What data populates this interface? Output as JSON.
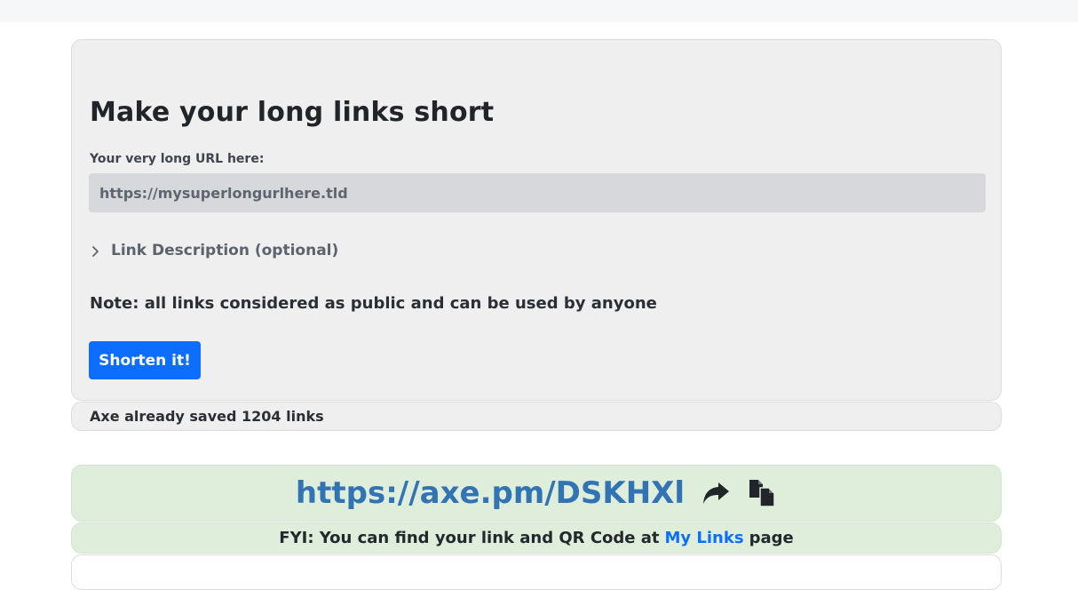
{
  "form": {
    "title": "Make your long links short",
    "url_label": "Your very long URL here:",
    "url_placeholder": "https://mysuperlongurlhere.tld",
    "url_value": "",
    "description_toggle": "Link Description (optional)",
    "note": "Note: all links considered as public and can be used by anyone",
    "submit_label": "Shorten it!"
  },
  "stats": {
    "text": "Axe already saved 1204 links"
  },
  "result": {
    "short_url": "https://axe.pm/DSKHXl",
    "share_icon": "share-arrow-icon",
    "copy_icon": "copy-icon",
    "fyi_prefix": "FYI: You can find your link and QR Code at",
    "fyi_link": "My Links",
    "fyi_suffix": "page"
  },
  "colors": {
    "primary": "#0d6efd",
    "link": "#3273b4",
    "success_bg": "#deeedb",
    "card_bg": "#efefef"
  }
}
